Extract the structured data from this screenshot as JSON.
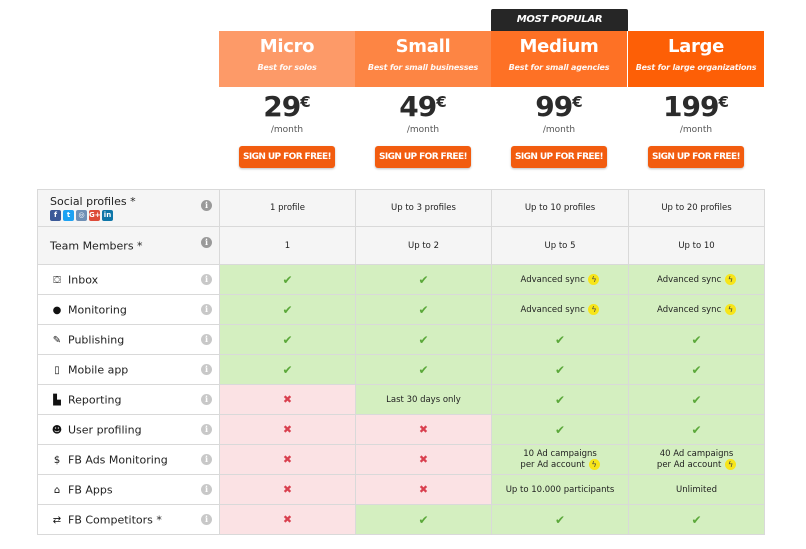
{
  "badge": "MOST POPULAR",
  "plans": [
    {
      "name": "Micro",
      "tagline": "Best for solos",
      "price": "29",
      "currency": "€",
      "period": "/month",
      "cta": "SIGN UP FOR FREE!",
      "color": "#fd9a68"
    },
    {
      "name": "Small",
      "tagline": "Best for small businesses",
      "price": "49",
      "currency": "€",
      "period": "/month",
      "cta": "SIGN UP FOR FREE!",
      "color": "#fd8544"
    },
    {
      "name": "Medium",
      "tagline": "Best for small agencies",
      "price": "99",
      "currency": "€",
      "period": "/month",
      "cta": "SIGN UP FOR FREE!",
      "color": "#fe7125"
    },
    {
      "name": "Large",
      "tagline": "Best for large organizations",
      "price": "199",
      "currency": "€",
      "period": "/month",
      "cta": "SIGN UP FOR FREE!",
      "color": "#fd5f06"
    }
  ],
  "info_glyph": "i",
  "social_icons": [
    "facebook-icon",
    "twitter-icon",
    "instagram-icon",
    "google-plus-icon",
    "linkedin-icon"
  ],
  "rows": [
    {
      "label": "Social profiles *",
      "icon": "",
      "cells": [
        {
          "text": "1 profile"
        },
        {
          "text": "Up to 3 profiles"
        },
        {
          "text": "Up to 10 profiles"
        },
        {
          "text": "Up to 20 profiles"
        }
      ]
    },
    {
      "label": "Team Members *",
      "icon": "",
      "cells": [
        {
          "text": "1"
        },
        {
          "text": "Up to 2"
        },
        {
          "text": "Up to 5"
        },
        {
          "text": "Up to 10"
        }
      ]
    },
    {
      "label": "Inbox",
      "icon": "inbox-icon",
      "glyph": "⛋",
      "cells": [
        {
          "status": "yes"
        },
        {
          "status": "yes"
        },
        {
          "status": "yes",
          "text": "Advanced sync",
          "bolt": true
        },
        {
          "status": "yes",
          "text": "Advanced sync",
          "bolt": true
        }
      ]
    },
    {
      "label": "Monitoring",
      "icon": "globe-icon",
      "glyph": "●",
      "cells": [
        {
          "status": "yes"
        },
        {
          "status": "yes"
        },
        {
          "status": "yes",
          "text": "Advanced sync",
          "bolt": true
        },
        {
          "status": "yes",
          "text": "Advanced sync",
          "bolt": true
        }
      ]
    },
    {
      "label": "Publishing",
      "icon": "pencil-icon",
      "glyph": "✎",
      "cells": [
        {
          "status": "yes"
        },
        {
          "status": "yes"
        },
        {
          "status": "yes"
        },
        {
          "status": "yes"
        }
      ]
    },
    {
      "label": "Mobile app",
      "icon": "mobile-icon",
      "glyph": "▯",
      "cells": [
        {
          "status": "yes"
        },
        {
          "status": "yes"
        },
        {
          "status": "yes"
        },
        {
          "status": "yes"
        }
      ]
    },
    {
      "label": "Reporting",
      "icon": "bar-chart-icon",
      "glyph": "▙",
      "cells": [
        {
          "status": "no"
        },
        {
          "status": "yes",
          "text": "Last 30 days only"
        },
        {
          "status": "yes"
        },
        {
          "status": "yes"
        }
      ]
    },
    {
      "label": "User profiling",
      "icon": "users-icon",
      "glyph": "☻",
      "cells": [
        {
          "status": "no"
        },
        {
          "status": "no"
        },
        {
          "status": "yes"
        },
        {
          "status": "yes"
        }
      ]
    },
    {
      "label": "FB Ads Monitoring",
      "icon": "dollar-icon",
      "glyph": "$",
      "cells": [
        {
          "status": "no"
        },
        {
          "status": "no"
        },
        {
          "status": "yes",
          "text": "10 Ad campaigns",
          "text2": "per Ad account",
          "bolt": true
        },
        {
          "status": "yes",
          "text": "40 Ad campaigns",
          "text2": "per Ad account",
          "bolt": true
        }
      ]
    },
    {
      "label": "FB Apps",
      "icon": "gift-icon",
      "glyph": "⌂",
      "cells": [
        {
          "status": "no"
        },
        {
          "status": "no"
        },
        {
          "status": "yes",
          "text": "Up to 10.000 participants"
        },
        {
          "status": "yes",
          "text": "Unlimited"
        }
      ]
    },
    {
      "label": "FB Competitors *",
      "icon": "exchange-icon",
      "glyph": "⇄",
      "cells": [
        {
          "status": "no"
        },
        {
          "status": "yes"
        },
        {
          "status": "yes"
        },
        {
          "status": "yes"
        }
      ]
    }
  ],
  "glyphs": {
    "check": "✔",
    "cross": "✖",
    "bolt": "ϟ"
  }
}
